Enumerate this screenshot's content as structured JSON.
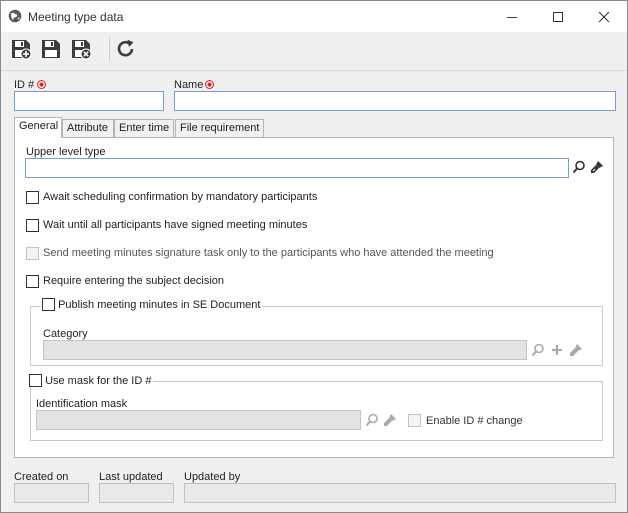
{
  "window": {
    "title": "Meeting type data",
    "controls": {
      "minimize": "minimize",
      "maximize": "maximize",
      "close": "close"
    }
  },
  "toolbar": {
    "buttons": [
      {
        "name": "save-and-new",
        "icon": "floppy-plus-icon"
      },
      {
        "name": "save",
        "icon": "floppy-icon"
      },
      {
        "name": "save-and-close",
        "icon": "floppy-close-icon"
      },
      {
        "name": "refresh",
        "icon": "refresh-icon"
      }
    ]
  },
  "fields": {
    "id_label": "ID #",
    "id_value": "",
    "name_label": "Name",
    "name_value": ""
  },
  "tabs": [
    {
      "label": "General",
      "active": true
    },
    {
      "label": "Attribute",
      "active": false
    },
    {
      "label": "Enter time",
      "active": false
    },
    {
      "label": "File requirement",
      "active": false
    }
  ],
  "general": {
    "upper_level_type_label": "Upper level type",
    "upper_level_type_value": "",
    "options": [
      {
        "label": "Await scheduling confirmation by mandatory participants",
        "checked": false,
        "disabled": false
      },
      {
        "label": "Wait until all participants have signed meeting minutes",
        "checked": false,
        "disabled": false
      },
      {
        "label": "Send meeting minutes signature task only to the participants who have attended the meeting",
        "checked": false,
        "disabled": true
      },
      {
        "label": "Require entering the subject decision",
        "checked": false,
        "disabled": false
      }
    ],
    "publish_group": {
      "label": "Publish meeting minutes in SE Document",
      "checked": false,
      "category_label": "Category",
      "category_value": ""
    },
    "mask_group": {
      "label": "Use mask for the ID #",
      "checked": false,
      "identification_mask_label": "Identification mask",
      "identification_mask_value": "",
      "enable_change_label": "Enable ID # change",
      "enable_change_checked": false
    }
  },
  "footer": {
    "created_on_label": "Created on",
    "created_on_value": "",
    "last_updated_label": "Last updated",
    "last_updated_value": "",
    "updated_by_label": "Updated by",
    "updated_by_value": ""
  },
  "colors": {
    "required_marker": "#d9232e",
    "input_border": "#7a9cc6",
    "panel_border": "#b5b5b5",
    "window_bg": "#f0f0f0"
  }
}
